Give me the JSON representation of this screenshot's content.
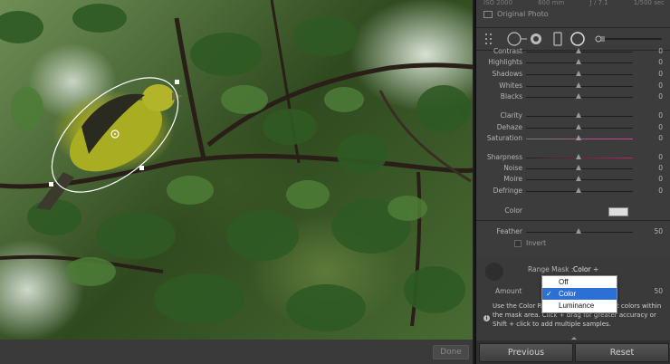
{
  "exif": {
    "iso": "ISO 2000",
    "focal": "600 mm",
    "aperture": "ƒ / 7.1",
    "shutter": "1/500 sec"
  },
  "original_photo_label": "Original Photo",
  "bottom_bar": {
    "done_label": "Done"
  },
  "sliders_a": [
    {
      "label": "Contrast",
      "value": "0"
    },
    {
      "label": "Highlights",
      "value": "0"
    },
    {
      "label": "Shadows",
      "value": "0"
    },
    {
      "label": "Whites",
      "value": "0"
    },
    {
      "label": "Blacks",
      "value": "0"
    }
  ],
  "sliders_b": [
    {
      "label": "Clarity",
      "value": "0"
    },
    {
      "label": "Dehaze",
      "value": "0"
    },
    {
      "label": "Saturation",
      "value": "0"
    }
  ],
  "sliders_c": [
    {
      "label": "Sharpness",
      "value": "0"
    },
    {
      "label": "Noise",
      "value": "0"
    },
    {
      "label": "Moire",
      "value": "0"
    },
    {
      "label": "Defringe",
      "value": "0"
    }
  ],
  "color_label": "Color",
  "feather": {
    "label": "Feather",
    "value": "50"
  },
  "invert_label": "Invert",
  "range_mask": {
    "label": "Range Mask :",
    "value": "Color"
  },
  "amount": {
    "label": "Amount",
    "value": "50"
  },
  "info_text": "Use the Color Range Mask tool to select colors within the mask area. Click + drag for greater accuracy or Shift + click to add multiple samples.",
  "dropdown": {
    "options": [
      "Off",
      "Color",
      "Luminance"
    ],
    "selected": "Color"
  },
  "buttons": {
    "previous": "Previous",
    "reset": "Reset"
  },
  "colors": {
    "accent": "#2c6fd5",
    "panel_bg": "#3c3c3c",
    "mask_line": "#ffffff"
  }
}
